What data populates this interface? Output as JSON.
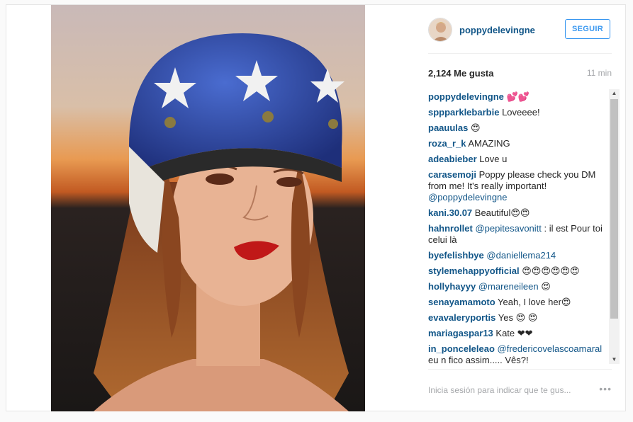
{
  "post": {
    "username": "poppydelevingne",
    "follow_label": "SEGUIR",
    "likes": "2,124 Me gusta",
    "time": "11 min"
  },
  "comments": [
    {
      "user": "poppydelevingne",
      "text": "💕💕",
      "mention": ""
    },
    {
      "user": "sppparklebarbie",
      "text": "Loveeee!",
      "mention": ""
    },
    {
      "user": "paauulas",
      "text": "😍",
      "mention": ""
    },
    {
      "user": "roza_r_k",
      "text": "AMAZING",
      "mention": ""
    },
    {
      "user": "adeabieber",
      "text": "Love u",
      "mention": ""
    },
    {
      "user": "carasemoji",
      "text": "Poppy please check you DM from me! It's really important!",
      "mention": "@poppydelevingne"
    },
    {
      "user": "kani.30.07",
      "text": "Beautiful😍😍",
      "mention": ""
    },
    {
      "user": "hahnrollet",
      "mention_first": "@pepitesavonitt",
      "text": ": il est Pour toi celui là"
    },
    {
      "user": "byefelishbye",
      "text": "",
      "mention": "@daniellema214"
    },
    {
      "user": "stylemehappyofficial",
      "text": "😍😍😍😍😍😍",
      "mention": ""
    },
    {
      "user": "hollyhayyy",
      "mention_first": "@mareneileen",
      "text": "😍"
    },
    {
      "user": "senayamamoto",
      "text": "Yeah, I love her😍",
      "mention": ""
    },
    {
      "user": "evavaleryportis",
      "text": "Yes 😍 😍",
      "mention": ""
    },
    {
      "user": "mariagaspar13",
      "text": "Kate ❤❤",
      "mention": ""
    },
    {
      "user": "in_ponceleleao",
      "mention_first": "@fredericovelascoamaral",
      "text": "eu n fico assim..... Vês?!"
    }
  ],
  "footer": {
    "login_hint": "Inicia sesión para indicar que te gus...",
    "more": "•••"
  },
  "colors": {
    "accent": "#3897f0",
    "username": "#125688",
    "muted": "#a5a7aa"
  }
}
